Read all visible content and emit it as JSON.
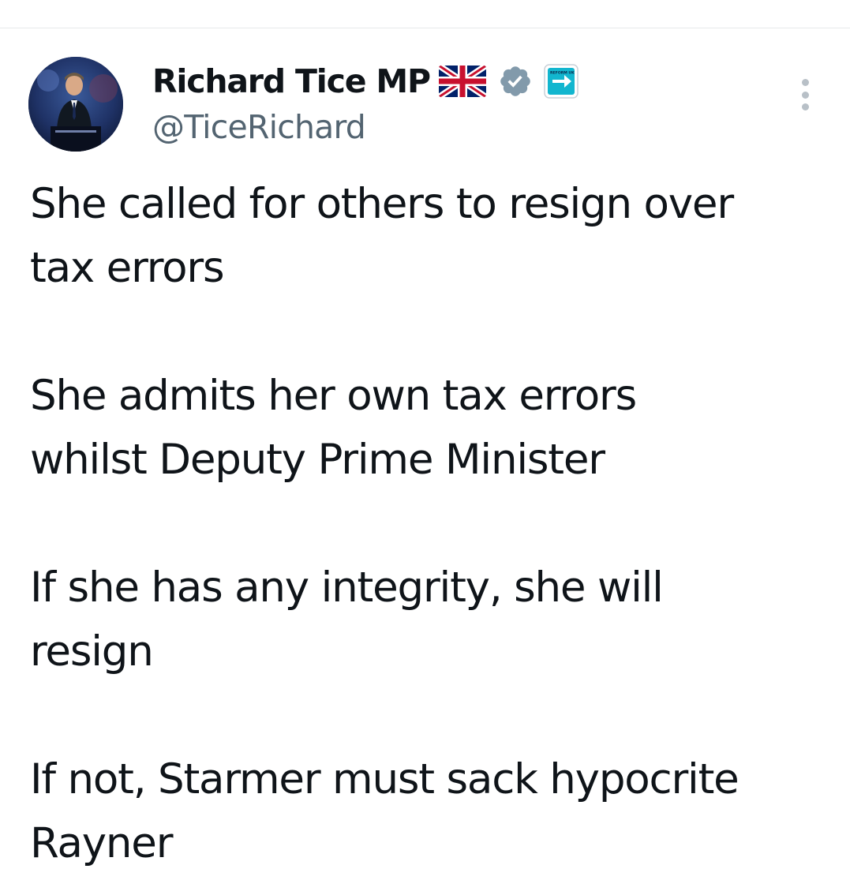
{
  "author": {
    "display_name": "Richard Tice MP",
    "handle": "@TiceRichard",
    "avatar": "profile-photo",
    "badges": [
      "uk-flag-icon",
      "verified-icon",
      "reform-uk-affiliate-icon"
    ],
    "affiliate_label": "REFORM UK"
  },
  "tweet": {
    "paragraphs": [
      "She called for others to resign over tax errors",
      "She admits her own tax errors whilst Deputy Prime Minister",
      "If she has any integrity, she will resign",
      "If not, Starmer must sack hypocrite Rayner"
    ],
    "lines": [
      [
        "She called for others to resign over",
        "tax errors"
      ],
      [
        "She admits her own tax errors",
        "whilst Deputy Prime Minister"
      ],
      [
        "If she has any integrity, she will",
        "resign"
      ],
      [
        "If not, Starmer must sack hypocrite",
        "Rayner"
      ]
    ]
  },
  "colors": {
    "text": "#0f1419",
    "secondary": "#536471",
    "link": "#1d9bf0",
    "verified": "#829aab",
    "affiliate": "#12b6cf"
  }
}
